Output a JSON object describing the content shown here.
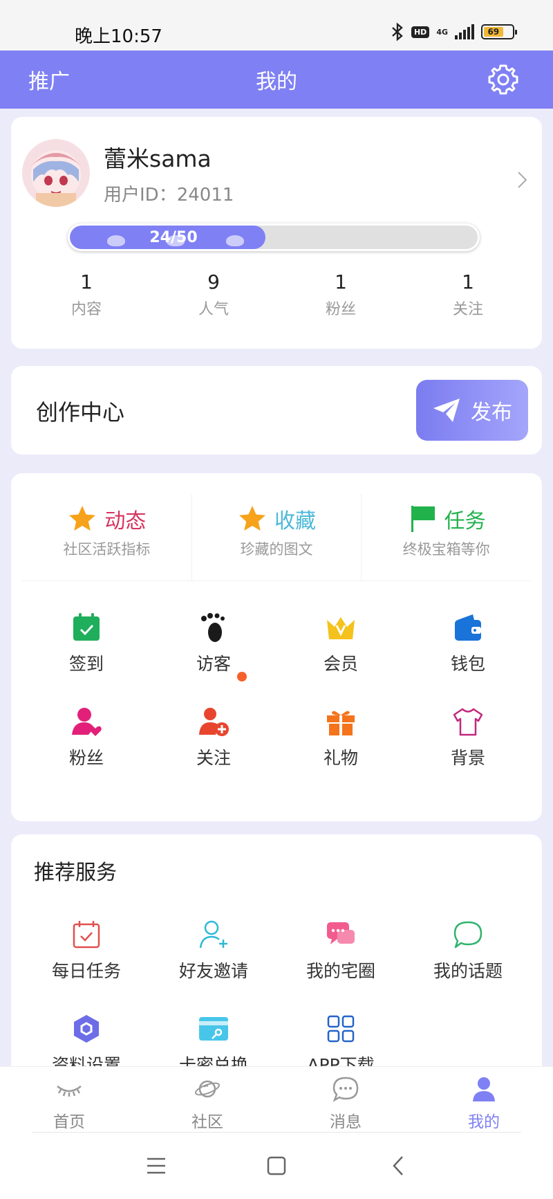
{
  "status_bar": {
    "time": "晚上10:57",
    "hd": "HD",
    "network": "4G",
    "battery": "69"
  },
  "header": {
    "left": "推广",
    "title": "我的"
  },
  "profile": {
    "name": "蕾米sama",
    "user_id": "用户ID：24011",
    "level_text": "24/50",
    "level_progress": 0.48,
    "stats": [
      {
        "value": "1",
        "label": "内容"
      },
      {
        "value": "9",
        "label": "人气"
      },
      {
        "value": "1",
        "label": "粉丝"
      },
      {
        "value": "1",
        "label": "关注"
      }
    ]
  },
  "creation": {
    "title": "创作中心",
    "publish_label": "发布"
  },
  "highlights": [
    {
      "title": "动态",
      "subtitle": "社区活跃指标",
      "color": "#d6345f",
      "icon": "star-icon"
    },
    {
      "title": "收藏",
      "subtitle": "珍藏的图文",
      "color": "#4cb8d8",
      "icon": "star-icon"
    },
    {
      "title": "任务",
      "subtitle": "终极宝箱等你",
      "color": "#22b24c",
      "icon": "flag-icon"
    }
  ],
  "features": [
    {
      "label": "签到",
      "icon": "calendar-check-icon"
    },
    {
      "label": "访客",
      "icon": "footprint-icon",
      "dot": true
    },
    {
      "label": "会员",
      "icon": "crown-icon"
    },
    {
      "label": "钱包",
      "icon": "wallet-icon"
    },
    {
      "label": "粉丝",
      "icon": "fan-heart-icon"
    },
    {
      "label": "关注",
      "icon": "user-add-icon"
    },
    {
      "label": "礼物",
      "icon": "gift-icon"
    },
    {
      "label": "背景",
      "icon": "shirt-icon"
    }
  ],
  "services": {
    "title": "推荐服务",
    "items": [
      {
        "label": "每日任务",
        "icon": "calendar-task-icon"
      },
      {
        "label": "好友邀请",
        "icon": "invite-friend-icon"
      },
      {
        "label": "我的宅圈",
        "icon": "chat-bubbles-icon"
      },
      {
        "label": "我的话题",
        "icon": "speech-bubble-icon"
      },
      {
        "label": "资料设置",
        "icon": "hexagon-settings-icon"
      },
      {
        "label": "卡密兑换",
        "icon": "card-key-icon"
      },
      {
        "label": "APP下载",
        "icon": "app-grid-icon"
      }
    ]
  },
  "tabs": [
    {
      "label": "首页",
      "icon": "eye-closed-icon",
      "active": false
    },
    {
      "label": "社区",
      "icon": "planet-icon",
      "active": false
    },
    {
      "label": "消息",
      "icon": "message-icon",
      "active": false
    },
    {
      "label": "我的",
      "icon": "person-icon",
      "active": true
    }
  ],
  "colors": {
    "accent": "#7f80f4",
    "background": "#ecebfa"
  }
}
